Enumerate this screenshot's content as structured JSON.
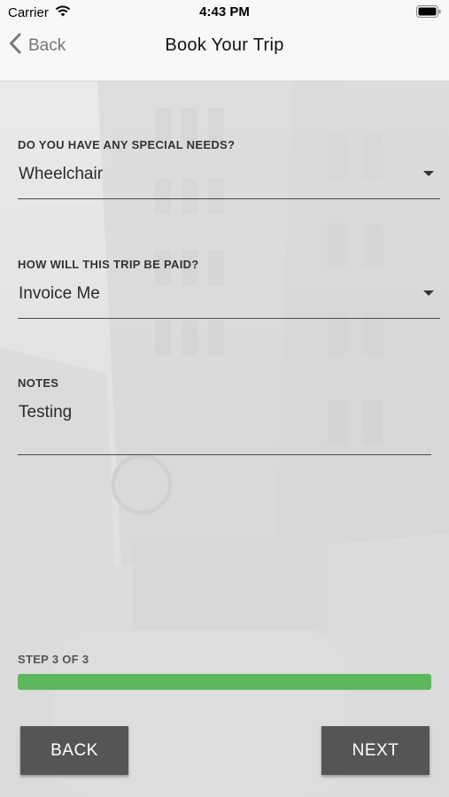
{
  "status_bar": {
    "carrier": "Carrier",
    "time": "4:43 PM"
  },
  "nav": {
    "back_label": "Back",
    "title": "Book Your Trip"
  },
  "form": {
    "special_needs": {
      "label": "DO YOU HAVE ANY SPECIAL NEEDS?",
      "value": "Wheelchair"
    },
    "payment": {
      "label": "HOW WILL THIS TRIP BE PAID?",
      "value": "Invoice Me"
    },
    "notes": {
      "label": "NOTES",
      "value": "Testing"
    }
  },
  "progress": {
    "label": "STEP 3 OF 3",
    "current_step": 3,
    "total_steps": 3,
    "fraction": 1.0,
    "color": "#5cb85c"
  },
  "buttons": {
    "back_label": "BACK",
    "next_label": "NEXT"
  },
  "icons": {
    "wifi": "wifi-icon",
    "battery": "battery-icon",
    "back": "chevron-left-icon",
    "dropdown": "caret-down-icon"
  }
}
